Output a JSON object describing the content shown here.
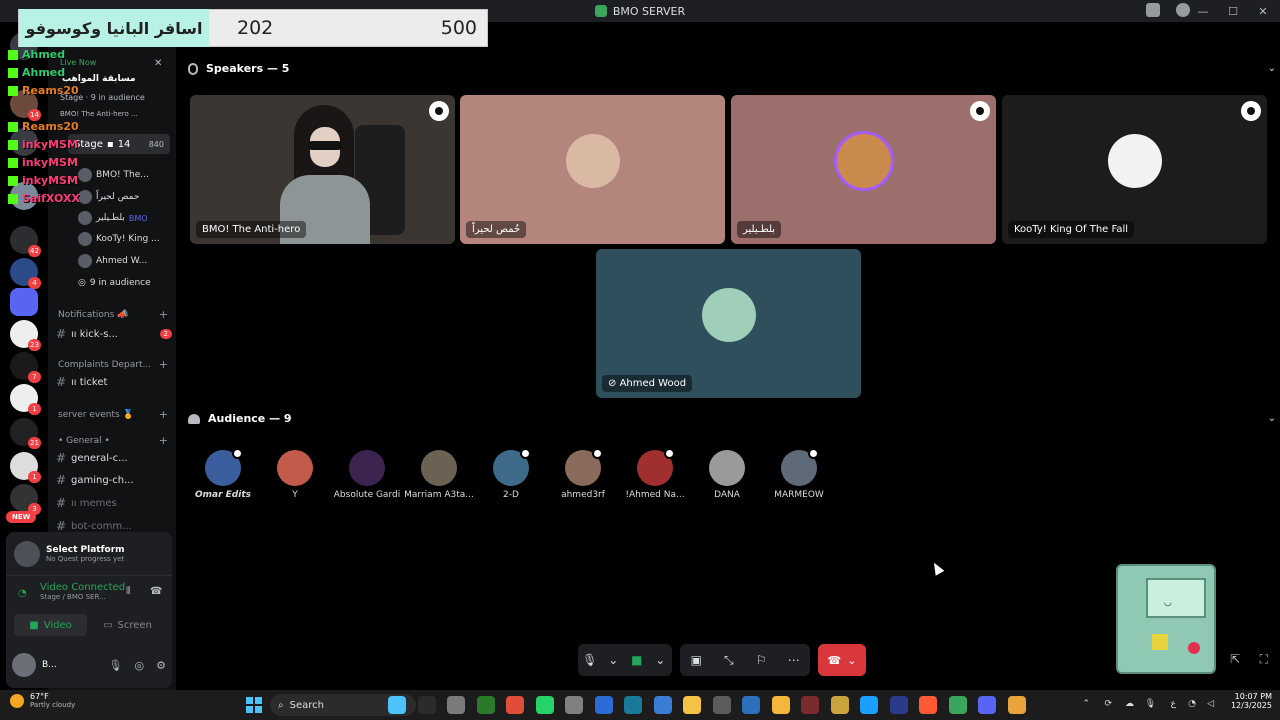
{
  "window": {
    "title": "BMO SERVER",
    "minimize": "—",
    "maximize": "☐",
    "close": "✕"
  },
  "overlay": {
    "scoreboard": {
      "team": "اسافر البانيا وكوسوفو",
      "value_a": "202",
      "value_b": "500"
    },
    "chat": [
      {
        "name": "Ahmed",
        "color": "#2ecc71"
      },
      {
        "name": "Ahmed",
        "color": "#2ecc71"
      },
      {
        "name": "Reams20",
        "color": "#e67e22"
      },
      {
        "name": "Reams20",
        "color": "#e67e22"
      },
      {
        "name": "inkyMSM",
        "color": "#ff3b7a"
      },
      {
        "name": "inkyMSM",
        "color": "#ff3b7a"
      },
      {
        "name": "inkyMSM",
        "color": "#ff3b7a"
      },
      {
        "name": "SaifXOXX",
        "color": "#ff3b7a"
      }
    ],
    "live_now": "Live Now",
    "live_title": "مسابقة المواهب",
    "live_sub": "Stage · 9 in audience",
    "live_event": "BMO! The Anti-hero ..."
  },
  "rail": {
    "badges": [
      "14",
      "42",
      "4",
      "23",
      "7",
      "1",
      "21",
      "1",
      "3"
    ],
    "new_label": "NEW"
  },
  "sidebar": {
    "stage": {
      "label": "Stage",
      "video_count": "14",
      "count": "840"
    },
    "speakers": [
      {
        "name": "BMO! The..."
      },
      {
        "name": "حمص لحيراً"
      },
      {
        "name": "بلطـيلير",
        "tag": "BMO"
      },
      {
        "name": "KooTy! King ..."
      },
      {
        "name": "Ahmed W..."
      }
    ],
    "audience_label": "9 in audience",
    "categories": [
      {
        "label": "Notifications 📣"
      },
      {
        "label": "Complaints Depart..."
      },
      {
        "label": "server events 🏅"
      },
      {
        "label": "• General •"
      }
    ],
    "channels": [
      {
        "name": "ıı kick-s...",
        "count": "2"
      },
      {
        "name": "ıı ticket"
      },
      {
        "name": "general-c..."
      },
      {
        "name": "gaming-ch..."
      },
      {
        "name": "ıı memes"
      },
      {
        "name": "bot-comm..."
      }
    ]
  },
  "panel": {
    "quest_title": "Select Platform",
    "quest_sub": "No Quest progress yet",
    "vc_title": "Video Connected",
    "vc_sub": "Stage / BMO SER...",
    "video_label": "Video",
    "screen_label": "Screen",
    "user_name": "B..."
  },
  "stage": {
    "speakers_header": "Speakers — 5",
    "audience_header": "Audience — 9",
    "speaker_tiles": [
      {
        "name": "BMO! The Anti-hero",
        "bg": "#3b3632"
      },
      {
        "name": "حُمص لحيراً",
        "bg": "#b3857d"
      },
      {
        "name": "بلطـيلير",
        "bg": "#9c6e6c"
      },
      {
        "name": "KooTy! King Of The Fall",
        "bg": "#1c1c1c"
      },
      {
        "name": "Ahmed Wood",
        "bg": "#2f4f5d"
      }
    ],
    "audience": [
      {
        "name": "Omar Edits",
        "color": "#3b5f9e"
      },
      {
        "name": "Y",
        "color": "#c45a4a"
      },
      {
        "name": "Absolute Gardi",
        "color": "#3b2450"
      },
      {
        "name": "Marriam A3ta...",
        "color": "#6b6253"
      },
      {
        "name": "2-D",
        "color": "#3e6a8a"
      },
      {
        "name": "ahmed3rf",
        "color": "#8a6b5b"
      },
      {
        "name": "!Ahmed Na...",
        "color": "#a0302f"
      },
      {
        "name": "DANA",
        "color": "#9a9a9a"
      },
      {
        "name": "MARMEOW",
        "color": "#5f6a78"
      }
    ]
  },
  "taskbar": {
    "temp": "67°F",
    "weather": "Partly cloudy",
    "search_label": "Search",
    "time": "10:07 PM",
    "date": "12/3/2025",
    "apps": [
      "#4cc2ff",
      "#2b2b2b",
      "#7a7a7a",
      "#2b7a2b",
      "#e04e39",
      "#25d366",
      "#808080",
      "#2b6bd6",
      "#1a7a9a",
      "#3a7bd5",
      "#f5c344",
      "#5c5c5c",
      "#2c6fbb",
      "#f5b73b",
      "#7a2b2b",
      "#c9a33b",
      "#1a9fff",
      "#2b3a8a",
      "#ff5a36",
      "#3ba55d",
      "#5865f2",
      "#e8a33b"
    ]
  }
}
